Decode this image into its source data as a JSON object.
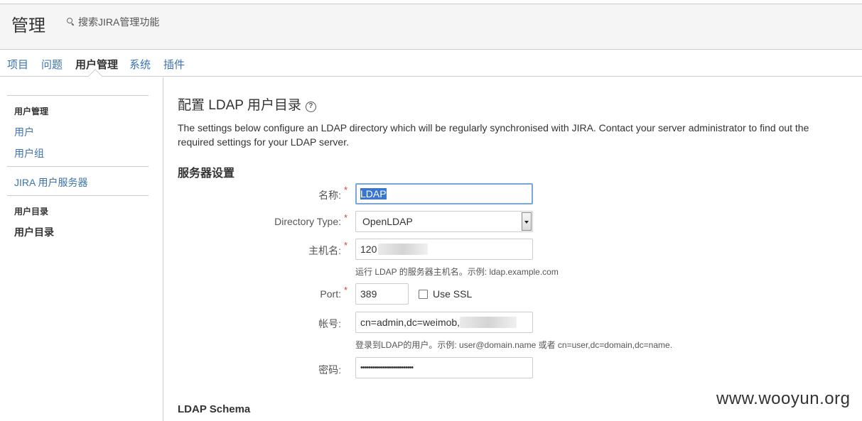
{
  "header": {
    "title": "管理",
    "search_label": "搜索JIRA管理功能"
  },
  "tabs": [
    {
      "label": "项目"
    },
    {
      "label": "问题"
    },
    {
      "label": "用户管理"
    },
    {
      "label": "系统"
    },
    {
      "label": "插件"
    }
  ],
  "active_tab": "用户管理",
  "sidebar": {
    "group1_heading": "用户管理",
    "group1_items": [
      {
        "label": "用户"
      },
      {
        "label": "用户组"
      }
    ],
    "jira_server": "JIRA 用户服务器",
    "group2_heading": "用户目录",
    "group2_current": "用户目录"
  },
  "main": {
    "title": "配置 LDAP 用户目录",
    "help_glyph": "?",
    "description": "The settings below configure an LDAP directory which will be regularly synchronised with JIRA. Contact your server administrator to find out the required settings for your LDAP server.",
    "server_section": "服务器设置",
    "schema_section": "LDAP Schema"
  },
  "form": {
    "name_label": "名称:",
    "name_value": "LDAP",
    "dirtype_label": "Directory Type:",
    "dirtype_value": "OpenLDAP",
    "host_label": "主机名:",
    "host_value": "120",
    "host_hint": "运行 LDAP 的服务器主机名。示例: ldap.example.com",
    "port_label": "Port:",
    "port_value": "389",
    "ssl_label": "Use SSL",
    "ssl_checked": false,
    "account_label": "帐号:",
    "account_value": "cn=admin,dc=weimob,",
    "account_hint": "登录到LDAP的用户。示例: user@domain.name 或者 cn=user,dc=domain,dc=name.",
    "password_label": "密码:",
    "password_value": "••••••••••••••••••••••••••",
    "required_mark": "*"
  },
  "watermark": "www.wooyun.org",
  "colors": {
    "link": "#3b73af",
    "required": "#d04437",
    "focus": "#7aa6d6",
    "selection": "#3875d7"
  }
}
